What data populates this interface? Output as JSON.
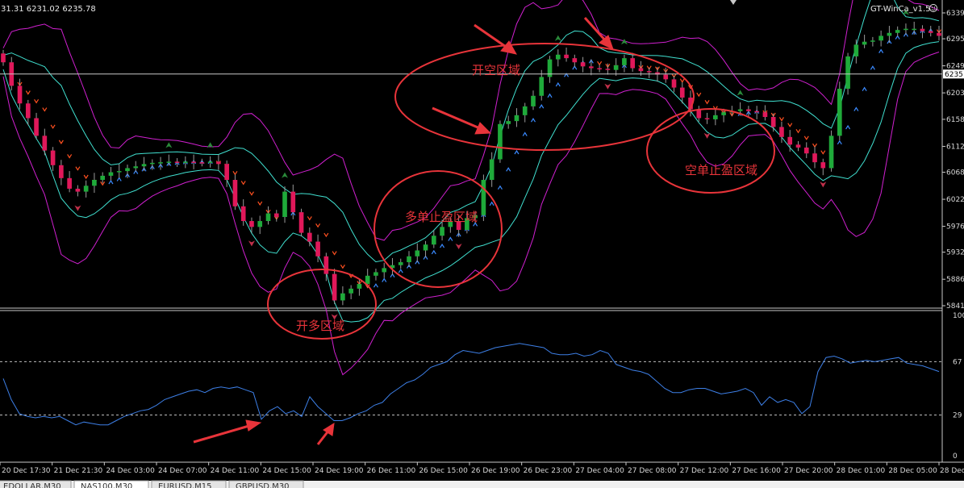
{
  "header": {
    "info_text": "31.31 6231.02 6235.78",
    "indicator_name": "GT-WinCa_v1.5",
    "indicator_icon": "smiley-icon"
  },
  "colors": {
    "background": "#000000",
    "bull_candle": "#1faa3a",
    "bear_candle": "#e0185a",
    "wick": "#9a9a9a",
    "band_outer": "#d020d0",
    "band_inner": "#40e0d0",
    "down_arrows": "#ff5020",
    "up_arrows": "#3a8aff",
    "oscillator": "#3d7fe6",
    "annotation": "#e8343a",
    "axis_text": "#d8d8d8"
  },
  "price_axis": {
    "current_price": "6235",
    "labels": [
      "6339",
      "6295",
      "6249",
      "6203",
      "6158",
      "6112",
      "6068",
      "6022",
      "5976",
      "5932",
      "5886",
      "5841"
    ]
  },
  "oscillator_axis": {
    "labels": [
      "100",
      "67",
      "29",
      "0"
    ],
    "levels": [
      67,
      29
    ]
  },
  "time_axis": {
    "labels": [
      "20 Dec 17:30",
      "21 Dec 21:30",
      "24 Dec 03:00",
      "24 Dec 07:00",
      "24 Dec 11:00",
      "24 Dec 15:00",
      "24 Dec 19:00",
      "26 Dec 11:00",
      "26 Dec 15:00",
      "26 Dec 19:00",
      "26 Dec 23:00",
      "27 Dec 04:00",
      "27 Dec 08:00",
      "27 Dec 12:00",
      "27 Dec 16:00",
      "27 Dec 20:00",
      "28 Dec 01:00",
      "28 Dec 05:00",
      "28 Dec"
    ]
  },
  "annotations": {
    "zone_long_open": "开多区域",
    "zone_long_tp": "多单止盈区域",
    "zone_short_open": "开空区域",
    "zone_short_tp": "空单止盈区域"
  },
  "tabs": [
    {
      "label": "EDOLLAR,M30",
      "active": false
    },
    {
      "label": "NAS100,M30",
      "active": true
    },
    {
      "label": "EURUSD,M15",
      "active": false
    },
    {
      "label": "GBPUSD,M30",
      "active": false
    }
  ],
  "chart_data": [
    {
      "type": "candlestick",
      "symbol": "NAS100",
      "timeframe": "M30",
      "ylim": [
        5841,
        6339
      ],
      "x_ticks": [
        "20 Dec 17:30",
        "21 Dec 21:30",
        "24 Dec 03:00",
        "24 Dec 07:00",
        "24 Dec 11:00",
        "24 Dec 15:00",
        "24 Dec 19:00",
        "26 Dec 11:00",
        "26 Dec 15:00",
        "26 Dec 19:00",
        "26 Dec 23:00",
        "27 Dec 04:00",
        "27 Dec 08:00",
        "27 Dec 12:00",
        "27 Dec 16:00",
        "27 Dec 20:00",
        "28 Dec 01:00",
        "28 Dec 05:00",
        "28 Dec"
      ],
      "y_ticks": [
        6339,
        6295,
        6249,
        6203,
        6158,
        6112,
        6068,
        6022,
        5976,
        5932,
        5886,
        5841
      ],
      "current_price": 6235,
      "close": [
        6255,
        6215,
        6185,
        6160,
        6130,
        6105,
        6080,
        6058,
        6040,
        6035,
        6045,
        6055,
        6062,
        6068,
        6070,
        6075,
        6078,
        6082,
        6084,
        6085,
        6086,
        6085,
        6086,
        6085,
        6084,
        6086,
        6082,
        6055,
        6010,
        5985,
        5975,
        5985,
        5998,
        5992,
        6035,
        6000,
        5965,
        5950,
        5925,
        5895,
        5850,
        5862,
        5870,
        5878,
        5892,
        5898,
        5905,
        5910,
        5915,
        5925,
        5935,
        5945,
        5960,
        5975,
        5985,
        5970,
        5990,
        5995,
        6055,
        6090,
        6150,
        6155,
        6165,
        6180,
        6198,
        6230,
        6260,
        6268,
        6262,
        6255,
        6248,
        6245,
        6244,
        6242,
        6250,
        6262,
        6245,
        6240,
        6238,
        6234,
        6226,
        6212,
        6195,
        6175,
        6160,
        6158,
        6165,
        6170,
        6172,
        6175,
        6172,
        6170,
        6162,
        6145,
        6128,
        6115,
        6110,
        6100,
        6085,
        6075,
        6130,
        6210,
        6265,
        6285,
        6290,
        6292,
        6300,
        6305,
        6310,
        6312,
        6312,
        6308,
        6305,
        6300
      ]
    },
    {
      "type": "line",
      "name": "oscillator",
      "ylim": [
        0,
        100
      ],
      "y_ticks": [
        100,
        67,
        29,
        0
      ],
      "levels": [
        67,
        29
      ],
      "values": [
        55,
        40,
        30,
        28,
        27,
        28,
        27,
        28,
        25,
        22,
        24,
        23,
        22,
        22,
        25,
        28,
        30,
        32,
        33,
        36,
        40,
        42,
        44,
        46,
        47,
        45,
        48,
        49,
        48,
        49,
        47,
        45,
        26,
        32,
        35,
        30,
        32,
        28,
        42,
        35,
        30,
        25,
        25,
        27,
        30,
        32,
        36,
        38,
        44,
        48,
        52,
        54,
        58,
        63,
        65,
        67,
        72,
        75,
        74,
        73,
        75,
        77,
        78,
        79,
        80,
        79,
        78,
        77,
        73,
        72,
        72,
        73,
        71,
        72,
        75,
        73,
        65,
        63,
        61,
        60,
        58,
        53,
        48,
        45,
        45,
        47,
        48,
        48,
        46,
        44,
        45,
        46,
        48,
        45,
        36,
        42,
        38,
        40,
        38,
        30,
        35,
        60,
        70,
        71,
        69,
        66,
        67,
        68,
        67,
        68,
        69,
        70,
        66,
        65,
        64,
        62,
        60
      ]
    }
  ]
}
